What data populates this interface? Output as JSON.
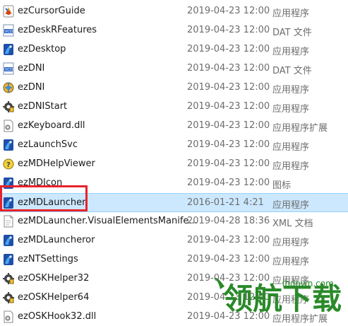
{
  "files": [
    {
      "name": "ezCursorGuide",
      "date": "2019-04-23 12:00",
      "type": "应用程序",
      "icon": "app-colorful-icon"
    },
    {
      "name": "ezDeskRFeatures",
      "date": "2019-04-23 12:00",
      "type": "DAT 文件",
      "icon": "vcd-file-icon"
    },
    {
      "name": "ezDesktop",
      "date": "2019-04-23 12:00",
      "type": "应用程序",
      "icon": "app-blue-icon"
    },
    {
      "name": "ezDNI",
      "date": "2019-04-23 12:00",
      "type": "DAT 文件",
      "icon": "vcd-file-icon"
    },
    {
      "name": "ezDNI",
      "date": "2019-04-23 12:00",
      "type": "应用程序",
      "icon": "app-globe-icon"
    },
    {
      "name": "ezDNIStart",
      "date": "2019-04-23 12:00",
      "type": "应用程序",
      "icon": "app-gear-icon"
    },
    {
      "name": "ezKeyboard.dll",
      "date": "2019-04-23 12:00",
      "type": "应用程序扩展",
      "icon": "dll-file-icon"
    },
    {
      "name": "ezLaunchSvc",
      "date": "2019-04-23 12:00",
      "type": "应用程序",
      "icon": "app-blue-icon"
    },
    {
      "name": "ezMDHelpViewer",
      "date": "2019-04-23 12:00",
      "type": "应用程序",
      "icon": "app-help-icon"
    },
    {
      "name": "ezMDIcon",
      "date": "2019-04-23 12:00",
      "type": "图标",
      "icon": "app-blue-icon"
    },
    {
      "name": "ezMDLauncher",
      "date": "2016-01-21 4:21",
      "type": "应用程序",
      "icon": "app-blue-icon"
    },
    {
      "name": "ezMDLauncher.VisualElementsManife...",
      "date": "2019-04-28 18:36",
      "type": "XML 文档",
      "icon": "xml-file-icon"
    },
    {
      "name": "ezMDLauncheror",
      "date": "2019-04-23 12:00",
      "type": "应用程序",
      "icon": "app-blue-icon"
    },
    {
      "name": "ezNTSettings",
      "date": "2019-04-23 12:00",
      "type": "应用程序",
      "icon": "app-blue-icon"
    },
    {
      "name": "ezOSKHelper32",
      "date": "2019-04-23 12:00",
      "type": "应用程序",
      "icon": "app-gear-icon"
    },
    {
      "name": "ezOSKHelper64",
      "date": "2019-04-23 12:00",
      "type": "应用程序",
      "icon": "app-gear-icon"
    },
    {
      "name": "ezOSKHook32.dll",
      "date": "2019-04-23 12:00",
      "type": "应用程序扩展",
      "icon": "dll-file-icon"
    }
  ],
  "selected_index": 10,
  "watermark": {
    "text": "领航下载",
    "url": "lhdown.com"
  },
  "colors": {
    "selection": "#cce8ff",
    "highlight_box": "#e8232c",
    "watermark": "#2a8a2a"
  }
}
